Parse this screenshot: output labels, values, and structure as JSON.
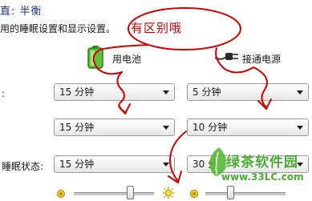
{
  "plan": {
    "title": "直: 半衡",
    "description": "用的睡眠设置和显示设置。"
  },
  "columns": {
    "on_battery": "用电池",
    "plugged_in": "接通电源"
  },
  "rows": [
    {
      "label": ":",
      "on_battery": "15 分钟",
      "plugged_in": "5 分钟"
    },
    {
      "label": "",
      "on_battery": "15 分钟",
      "plugged_in": "10 分钟"
    },
    {
      "label": "睡眠状态:",
      "on_battery": "15 分钟",
      "plugged_in": "30 分"
    }
  ],
  "brightness": {
    "on_battery": 0.72,
    "plugged_in": 0.3
  },
  "annotation": {
    "text": "有区别哦",
    "color": "#cc0000"
  },
  "watermark": {
    "name": "绿茶软件园",
    "url": "www.33LC.com",
    "color": "#3aa21f"
  },
  "icons": {
    "battery": "battery-icon",
    "plug": "power-plug-icon",
    "dim": "brightness-low-icon",
    "bright": "brightness-high-icon"
  }
}
